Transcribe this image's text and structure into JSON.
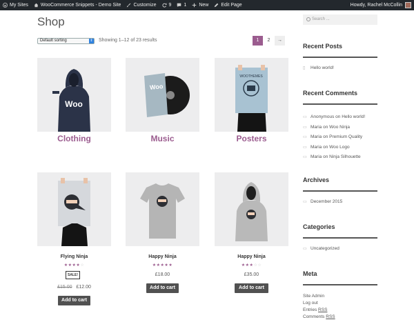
{
  "adminbar": {
    "my_sites": "My Sites",
    "site_name": "WooCommerce Snippets - Demo Site",
    "customize": "Customize",
    "updates_count": "9",
    "comments_count": "1",
    "new": "New",
    "edit_page": "Edit Page",
    "howdy": "Howdy, Rachel McCollin"
  },
  "page": {
    "title": "Shop",
    "orderby_selected": "Default sorting",
    "result_count": "Showing 1–12 of 23 results",
    "pagination": [
      "1",
      "2",
      "→"
    ]
  },
  "categories": [
    {
      "name": "Clothing"
    },
    {
      "name": "Music"
    },
    {
      "name": "Posters"
    }
  ],
  "products": [
    {
      "title": "Flying Ninja",
      "rating": 4,
      "sale_badge": "SALE!",
      "old_price": "£15.00",
      "price": "£12.00",
      "button": "Add to cart"
    },
    {
      "title": "Happy Ninja",
      "rating": 5,
      "price": "£18.00",
      "button": "Add to cart"
    },
    {
      "title": "Happy Ninja",
      "rating": 3,
      "price": "£35.00",
      "button": "Add to cart"
    }
  ],
  "sidebar": {
    "search_placeholder": "Search ...",
    "recent_posts": {
      "title": "Recent Posts",
      "items": [
        "Hello world!"
      ]
    },
    "recent_comments": {
      "title": "Recent Comments",
      "items": [
        {
          "author": "Anonymous",
          "on": "on",
          "post": "Hello world!"
        },
        {
          "author": "Maria",
          "on": "on",
          "post": "Woo Ninja"
        },
        {
          "author": "Maria",
          "on": "on",
          "post": "Premium Quality"
        },
        {
          "author": "Maria",
          "on": "on",
          "post": "Woo Logo"
        },
        {
          "author": "Maria",
          "on": "on",
          "post": "Ninja Silhouette"
        }
      ]
    },
    "archives": {
      "title": "Archives",
      "items": [
        "December 2015"
      ]
    },
    "categories": {
      "title": "Categories",
      "items": [
        "Uncategorized"
      ]
    },
    "meta": {
      "title": "Meta",
      "items": [
        "Site Admin",
        "Log out",
        "Entries",
        "RSS",
        "Comments",
        "RSS"
      ]
    }
  },
  "colors": {
    "accent": "#9b5c8f",
    "adminbar": "#23282d",
    "button": "#515151"
  }
}
